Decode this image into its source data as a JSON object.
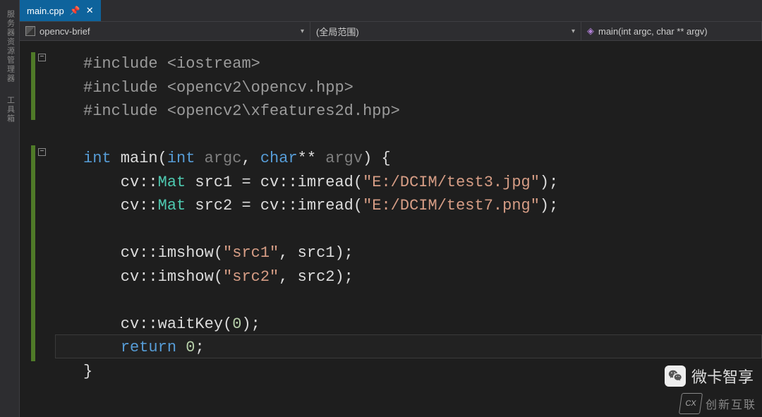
{
  "side": {
    "label1": "服务器资源管理器",
    "label2": "工具箱"
  },
  "tab": {
    "name": "main.cpp",
    "pin": "�români",
    "close": "✕"
  },
  "nav": {
    "scope_left": "opencv-brief",
    "scope_mid": "(全局范围)",
    "scope_right": "main(int argc, char ** argv)"
  },
  "code": {
    "l1_a": "#include ",
    "l1_b": "<iostream>",
    "l2_a": "#include ",
    "l2_b": "<opencv2\\opencv.hpp>",
    "l3_a": "#include ",
    "l3_b": "<opencv2\\xfeatures2d.hpp>",
    "l5_int": "int",
    "l5_main": " main(",
    "l5_int2": "int",
    "l5_argc": " argc",
    "l5_comma": ", ",
    "l5_char": "char",
    "l5_star": "**",
    "l5_argv": " argv",
    "l5_end": ") {",
    "l6_a": "    cv::",
    "l6_mat": "Mat",
    "l6_b": " src1 = cv::imread(",
    "l6_str": "\"E:/DCIM/test3.jpg\"",
    "l6_c": ");",
    "l7_a": "    cv::",
    "l7_mat": "Mat",
    "l7_b": " src2 = cv::imread(",
    "l7_str": "\"E:/DCIM/test7.png\"",
    "l7_c": ");",
    "l9_a": "    cv::imshow(",
    "l9_str": "\"src1\"",
    "l9_b": ", src1);",
    "l10_a": "    cv::imshow(",
    "l10_str": "\"src2\"",
    "l10_b": ", src2);",
    "l12_a": "    cv::waitKey(",
    "l12_num": "0",
    "l12_b": ");",
    "l13_a": "    ",
    "l13_ret": "return",
    "l13_b": " ",
    "l13_num": "0",
    "l13_c": ";",
    "l14": "}"
  },
  "watermark": {
    "text": "微卡智享",
    "logo": "创新互联"
  }
}
